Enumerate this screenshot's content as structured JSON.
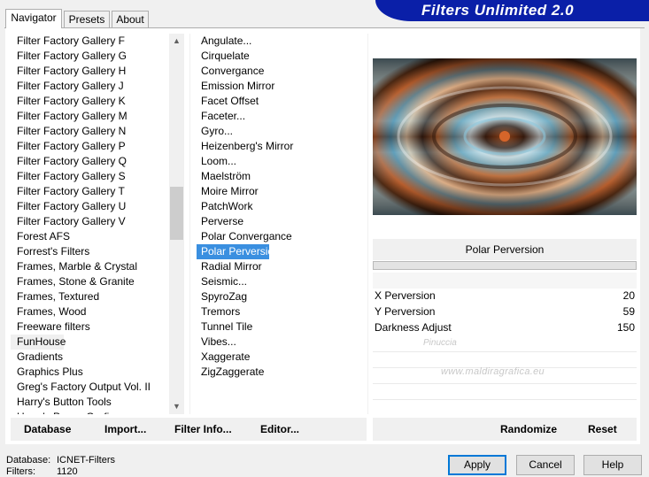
{
  "tabs": [
    {
      "label": "Navigator"
    },
    {
      "label": "Presets"
    },
    {
      "label": "About"
    }
  ],
  "banner": {
    "title": "Filters Unlimited 2.0"
  },
  "categories": [
    "Filter Factory Gallery F",
    "Filter Factory Gallery G",
    "Filter Factory Gallery H",
    "Filter Factory Gallery J",
    "Filter Factory Gallery K",
    "Filter Factory Gallery M",
    "Filter Factory Gallery N",
    "Filter Factory Gallery P",
    "Filter Factory Gallery Q",
    "Filter Factory Gallery S",
    "Filter Factory Gallery T",
    "Filter Factory Gallery U",
    "Filter Factory Gallery V",
    "Forest AFS",
    "Forrest's Filters",
    "Frames, Marble & Crystal",
    "Frames, Stone & Granite",
    "Frames, Textured",
    "Frames, Wood",
    "Freeware filters",
    "FunHouse",
    "Gradients",
    "Graphics Plus",
    "Greg's Factory Output Vol. II",
    "Harry's Button Tools",
    "Harry's Power Grafix"
  ],
  "selected_category": "FunHouse",
  "filters": [
    "Angulate...",
    "Cirquelate",
    "Convergance",
    "Emission Mirror",
    "Facet Offset",
    "Faceter...",
    "Gyro...",
    "Heizenberg's Mirror",
    "Loom...",
    "Maelström",
    "Moire Mirror",
    "PatchWork",
    "Perverse",
    "Polar Convergance",
    "Polar Perversion",
    "Radial Mirror",
    "Seismic...",
    "SpyroZag",
    "Tremors",
    "Tunnel Tile",
    "Vibes...",
    "Xaggerate",
    "ZigZaggerate"
  ],
  "selected_filter": "Polar Perversion",
  "params": {
    "title": "Polar Perversion",
    "rows": [
      {
        "label": "X Perversion",
        "value": "20"
      },
      {
        "label": "Y Perversion",
        "value": "59"
      },
      {
        "label": "Darkness Adjust",
        "value": "150"
      }
    ]
  },
  "bottom_buttons": {
    "database": "Database",
    "import": "Import...",
    "filter_info": "Filter Info...",
    "editor": "Editor...",
    "randomize": "Randomize",
    "reset": "Reset"
  },
  "footer": {
    "database_label": "Database:",
    "database_value": "ICNET-Filters",
    "filters_label": "Filters:",
    "filters_value": "1120"
  },
  "dialog_buttons": {
    "apply": "Apply",
    "cancel": "Cancel",
    "help": "Help"
  },
  "watermark": {
    "line1": "Pinuccia",
    "line2": "www.maldiragrafica.eu"
  },
  "colors": {
    "accent": "#0078d7",
    "selection": "#3a8fe0",
    "banner": "#0a1fa8"
  }
}
